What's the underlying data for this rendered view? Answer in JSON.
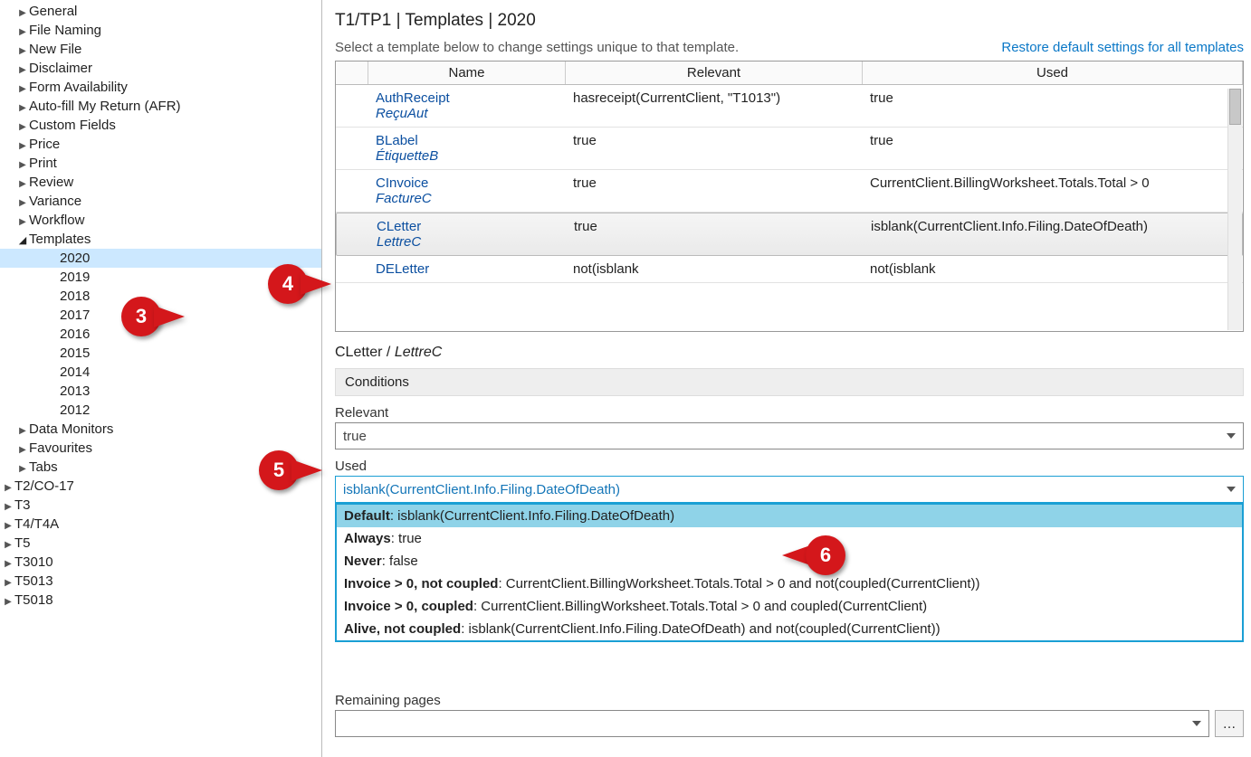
{
  "sidebar": {
    "top": [
      {
        "label": "General"
      },
      {
        "label": "File Naming"
      },
      {
        "label": "New File"
      },
      {
        "label": "Disclaimer"
      },
      {
        "label": "Form Availability"
      },
      {
        "label": "Auto-fill My Return (AFR)"
      },
      {
        "label": "Custom Fields"
      },
      {
        "label": "Price"
      },
      {
        "label": "Print"
      },
      {
        "label": "Review"
      },
      {
        "label": "Variance"
      },
      {
        "label": "Workflow"
      }
    ],
    "templates_label": "Templates",
    "years": [
      "2020",
      "2019",
      "2018",
      "2017",
      "2016",
      "2015",
      "2014",
      "2013",
      "2012"
    ],
    "after": [
      {
        "label": "Data Monitors"
      },
      {
        "label": "Favourites"
      },
      {
        "label": "Tabs"
      }
    ],
    "root_after": [
      {
        "label": "T2/CO-17"
      },
      {
        "label": "T3"
      },
      {
        "label": "T4/T4A"
      },
      {
        "label": "T5"
      },
      {
        "label": "T3010"
      },
      {
        "label": "T5013"
      },
      {
        "label": "T5018"
      }
    ]
  },
  "page_title": "T1/TP1 | Templates | 2020",
  "instruction": "Select a template below to change settings unique to that template.",
  "restore_link": "Restore default settings for all templates",
  "columns": {
    "name": "Name",
    "relevant": "Relevant",
    "used": "Used"
  },
  "rows": [
    {
      "name": "AuthReceipt",
      "alt": "ReçuAut",
      "relevant": "hasreceipt(CurrentClient, \"T1013\")",
      "used": "true"
    },
    {
      "name": "BLabel",
      "alt": "ÉtiquetteB",
      "relevant": "true",
      "used": "true"
    },
    {
      "name": "CInvoice",
      "alt": "FactureC",
      "relevant": "true",
      "used": "CurrentClient.BillingWorksheet.Totals.Total > 0"
    },
    {
      "name": "CLetter",
      "alt": "LettreC",
      "relevant": "true",
      "used": "isblank(CurrentClient.Info.Filing.DateOfDeath)",
      "selected": true
    },
    {
      "name": "DELetter",
      "alt": "",
      "relevant": "not(isblank",
      "used": "not(isblank"
    }
  ],
  "detail": {
    "name": "CLetter",
    "alt": "LettreC",
    "conditions_label": "Conditions",
    "relevant_label": "Relevant",
    "relevant_value": "true",
    "used_label": "Used",
    "used_value": "isblank(CurrentClient.Info.Filing.DateOfDeath)",
    "options": [
      {
        "prefix": "Default",
        "text": ": isblank(CurrentClient.Info.Filing.DateOfDeath)",
        "selected": true
      },
      {
        "prefix": "Always",
        "text": ": true"
      },
      {
        "prefix": "Never",
        "text": ": false"
      },
      {
        "prefix": "Invoice > 0, not coupled",
        "text": ": CurrentClient.BillingWorksheet.Totals.Total > 0 and not(coupled(CurrentClient))"
      },
      {
        "prefix": "Invoice > 0, coupled",
        "text": ": CurrentClient.BillingWorksheet.Totals.Total > 0 and coupled(CurrentClient)"
      },
      {
        "prefix": "Alive, not coupled",
        "text": ": isblank(CurrentClient.Info.Filing.DateOfDeath) and not(coupled(CurrentClient))"
      }
    ],
    "remaining_label": "Remaining pages"
  },
  "callouts": {
    "c3": "3",
    "c4": "4",
    "c5": "5",
    "c6": "6"
  }
}
